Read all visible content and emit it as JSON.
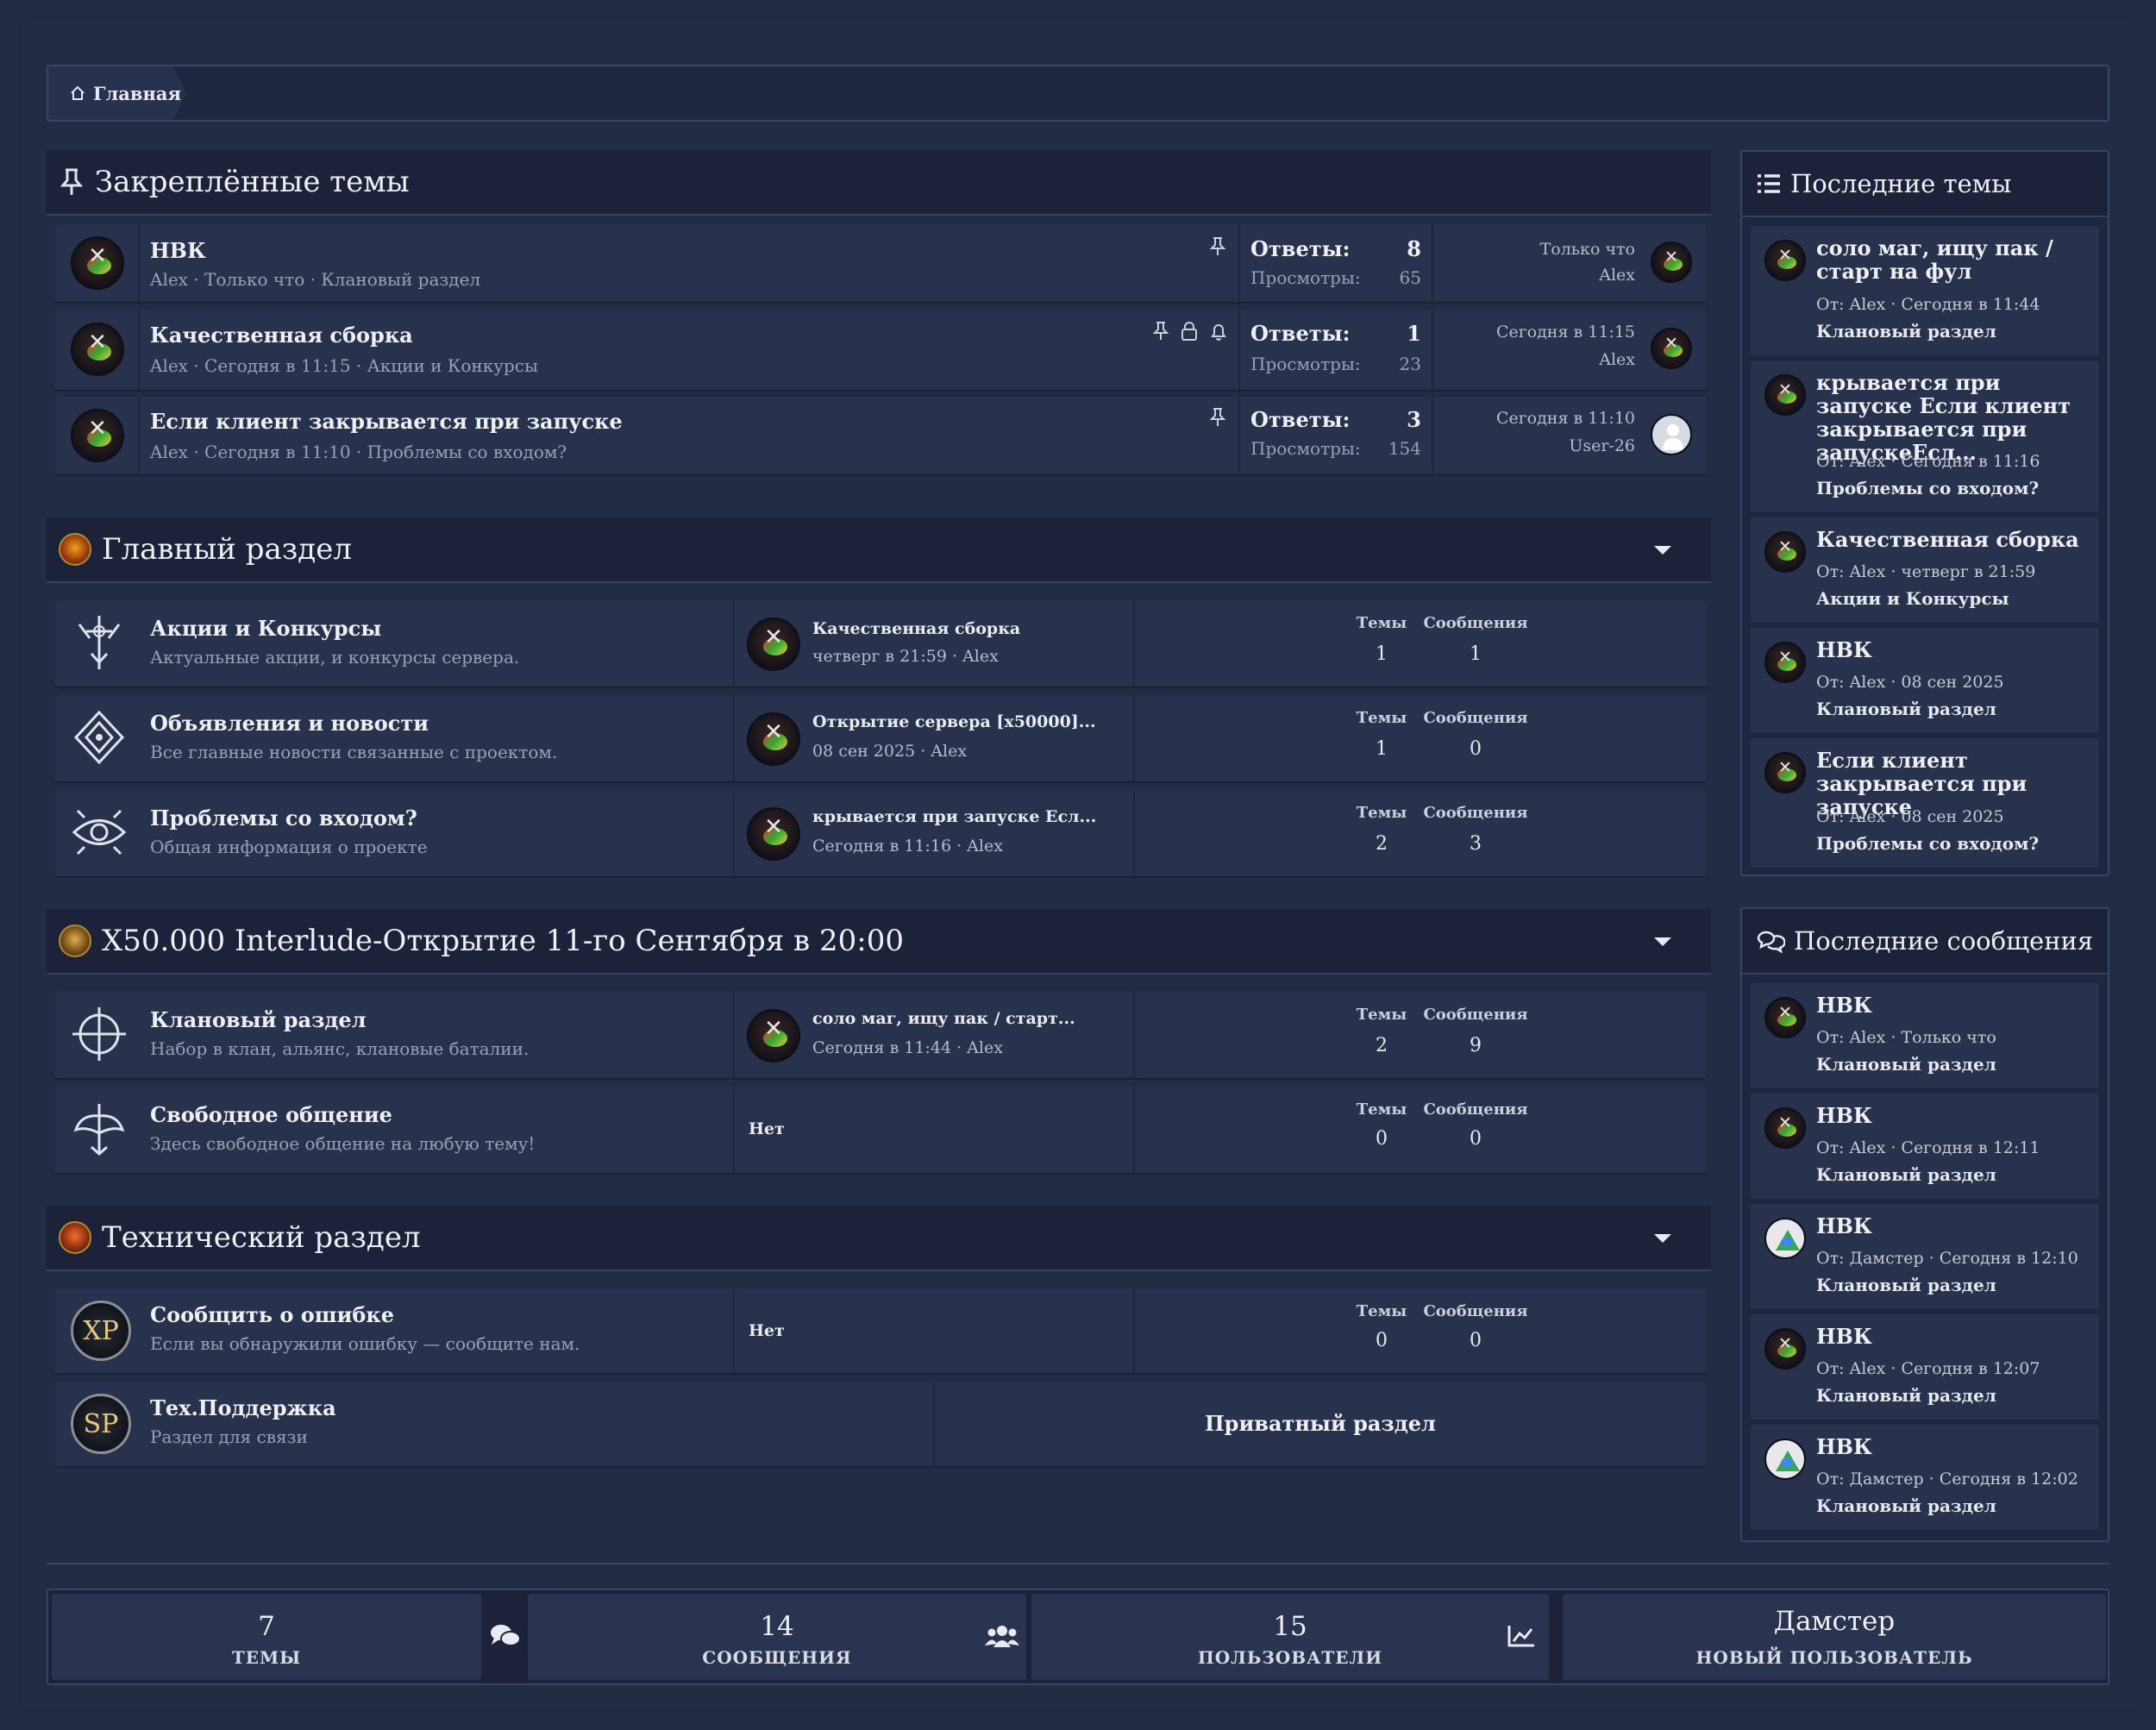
{
  "breadcrumb": {
    "home": "Главная"
  },
  "pinned": {
    "title": "Закреплённые темы",
    "replies_label": "Ответы:",
    "views_label": "Просмотры:",
    "topics": [
      {
        "title": "НВК",
        "meta": "Alex · Только что · Клановый раздел",
        "replies": "8",
        "views": "65",
        "last_time": "Только что",
        "last_user": "Alex",
        "icons": [
          "pin-icon"
        ]
      },
      {
        "title": "Качественная сборка",
        "meta": "Alex · Сегодня в 11:15 · Акции и Конкурсы",
        "replies": "1",
        "views": "23",
        "last_time": "Сегодня в 11:15",
        "last_user": "Alex",
        "icons": [
          "pin-icon",
          "lock-icon",
          "bell-icon"
        ]
      },
      {
        "title": "Если клиент закрывается при запуске",
        "meta": "Alex · Сегодня в 11:10 · Проблемы со входом?",
        "replies": "3",
        "views": "154",
        "last_time": "Сегодня в 11:10",
        "last_user": "User-26",
        "icons": [
          "pin-icon"
        ]
      }
    ]
  },
  "labels": {
    "topics": "Темы",
    "messages": "Сообщения",
    "none": "Нет",
    "private": "Приватный раздел"
  },
  "categories": [
    {
      "title": "Главный раздел",
      "forums": [
        {
          "name": "Акции и Конкурсы",
          "desc": "Актуальные акции, и конкурсы сервера.",
          "last_title": "Качественная сборка",
          "last_meta": "четверг в 21:59 · Alex",
          "topics": "1",
          "messages": "1"
        },
        {
          "name": "Объявления и новости",
          "desc": "Все главные новости связанные с проектом.",
          "last_title": "Открытие сервера [x50000]...",
          "last_meta": "08 сен 2025 · Alex",
          "topics": "1",
          "messages": "0"
        },
        {
          "name": "Проблемы со входом?",
          "desc": "Общая информация о проекте",
          "last_title": "крывается при запуске Есл...",
          "last_meta": "Сегодня в 11:16 · Alex",
          "topics": "2",
          "messages": "3"
        }
      ]
    },
    {
      "title": "X50.000 Interlude-Открытие 11-го Сентября в 20:00",
      "forums": [
        {
          "name": "Клановый раздел",
          "desc": "Набор в клан, альянс, клановые баталии.",
          "last_title": "соло маг, ищу пак / старт...",
          "last_meta": "Сегодня в 11:44 · Alex",
          "topics": "2",
          "messages": "9"
        },
        {
          "name": "Свободное общение",
          "desc": "Здесь свободное общение на любую тему!",
          "last_title": "",
          "last_meta": "",
          "topics": "0",
          "messages": "0"
        }
      ]
    },
    {
      "title": "Технический раздел",
      "forums": [
        {
          "name": "Сообщить о ошибке",
          "desc": "Если вы обнаружили ошибку — сообщите нам.",
          "icon_text": "XP",
          "topics": "0",
          "messages": "0"
        },
        {
          "name": "Тех.Поддержка",
          "desc": "Раздел для связи",
          "icon_text": "SP"
        }
      ]
    }
  ],
  "latest_topics": {
    "title": "Последние темы",
    "items": [
      {
        "title": "соло маг, ищу пак / старт на фул",
        "meta": "От: Alex · Сегодня в 11:44",
        "cat": "Клановый раздел"
      },
      {
        "title": "крывается при запуске Если клиент закрывается при запускеЕсл...",
        "meta": "От: Alex · Сегодня в 11:16",
        "cat": "Проблемы со входом?"
      },
      {
        "title": "Качественная сборка",
        "meta": "От: Alex · четверг в 21:59",
        "cat": "Акции и Конкурсы"
      },
      {
        "title": "НВК",
        "meta": "От: Alex · 08 сен 2025",
        "cat": "Клановый раздел"
      },
      {
        "title": "Если клиент закрывается при запуске",
        "meta": "От: Alex · 08 сен 2025",
        "cat": "Проблемы со входом?"
      }
    ]
  },
  "latest_posts": {
    "title": "Последние сообщения",
    "items": [
      {
        "title": "НВК",
        "meta": "От: Alex · Только что",
        "cat": "Клановый раздел"
      },
      {
        "title": "НВК",
        "meta": "От: Alex · Сегодня в 12:11",
        "cat": "Клановый раздел"
      },
      {
        "title": "НВК",
        "meta": "От: Дамстер · Сегодня в 12:10",
        "cat": "Клановый раздел"
      },
      {
        "title": "НВК",
        "meta": "От: Alex · Сегодня в 12:07",
        "cat": "Клановый раздел"
      },
      {
        "title": "НВК",
        "meta": "От: Дамстер · Сегодня в 12:02",
        "cat": "Клановый раздел"
      }
    ]
  },
  "stats": [
    {
      "value": "7",
      "label": "ТЕМЫ"
    },
    {
      "value": "14",
      "label": "СООБЩЕНИЯ"
    },
    {
      "value": "15",
      "label": "ПОЛЬЗОВАТЕЛИ"
    },
    {
      "value": "Дамстер",
      "label": "НОВЫЙ ПОЛЬЗОВАТЕЛЬ"
    }
  ]
}
